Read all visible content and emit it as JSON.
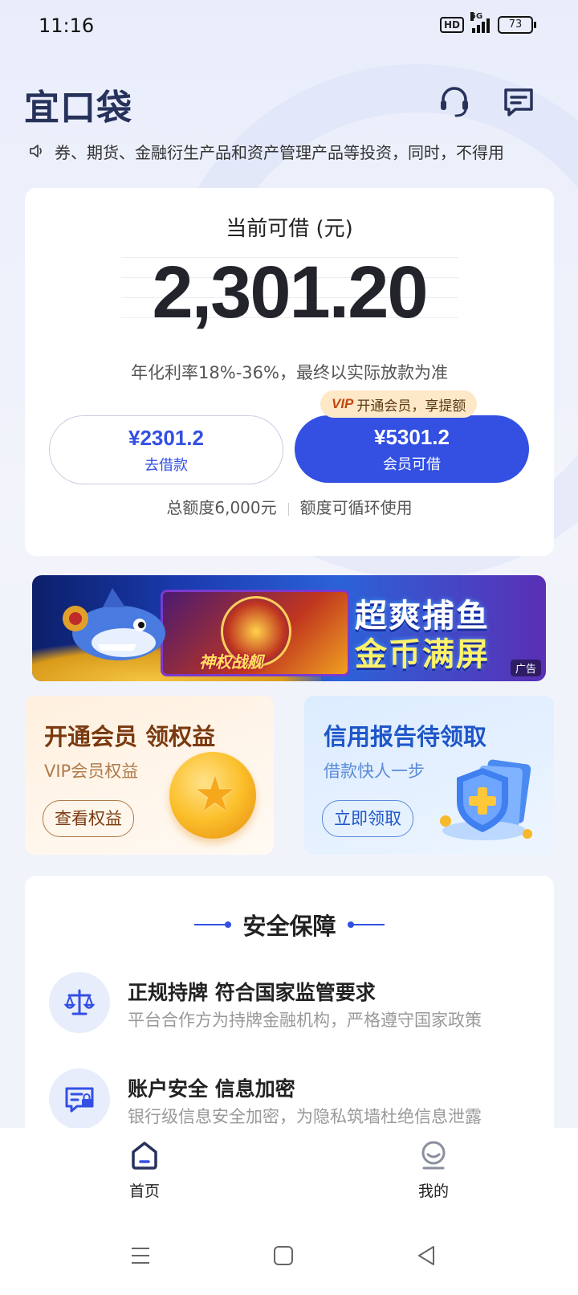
{
  "status_bar": {
    "time": "11:16",
    "hd": "HD",
    "network": "5G",
    "battery": "73"
  },
  "header": {
    "logo": "宜口袋",
    "support_icon": "headset-icon",
    "message_icon": "message-icon"
  },
  "notice": {
    "text": "券、期货、金融衍生产品和资产管理产品等投资，同时，不得用"
  },
  "loan_card": {
    "title": "当前可借 (元)",
    "amount": "2,301.20",
    "rate_note": "年化利率18%-36%，最终以实际放款为准",
    "borrow_button": {
      "amount": "¥2301.2",
      "label": "去借款"
    },
    "vip_button": {
      "amount": "¥5301.2",
      "label": "会员可借"
    },
    "vip_tag": {
      "logo": "VIP",
      "text": "开通会员，享提额"
    },
    "total_limit": "总额度6,000元",
    "recycle_note": "额度可循环使用"
  },
  "ad_banner": {
    "game_name": "神权战舰",
    "slogan_line1": "超爽捕鱼",
    "slogan_line2": "金币满屏",
    "ad_label": "广告"
  },
  "promo_cards": [
    {
      "title": "开通会员 领权益",
      "subtitle": "VIP会员权益",
      "button": "查看权益"
    },
    {
      "title": "信用报告待领取",
      "subtitle": "借款快人一步",
      "button": "立即领取"
    }
  ],
  "safety": {
    "title": "安全保障",
    "items": [
      {
        "title": "正规持牌 符合国家监管要求",
        "desc": "平台合作方为持牌金融机构，严格遵守国家政策",
        "icon": "scale-icon"
      },
      {
        "title": "账户安全 信息加密",
        "desc": "银行级信息安全加密，为隐私筑墙杜绝信息泄露",
        "icon": "secure-card-icon"
      }
    ]
  },
  "bottom_nav": {
    "items": [
      {
        "label": "首页",
        "icon": "home-icon",
        "active": true
      },
      {
        "label": "我的",
        "icon": "profile-icon",
        "active": false
      }
    ]
  },
  "colors": {
    "primary": "#3350e3",
    "logo": "#26325a",
    "vip_tag_bg": "#fde8c8"
  }
}
